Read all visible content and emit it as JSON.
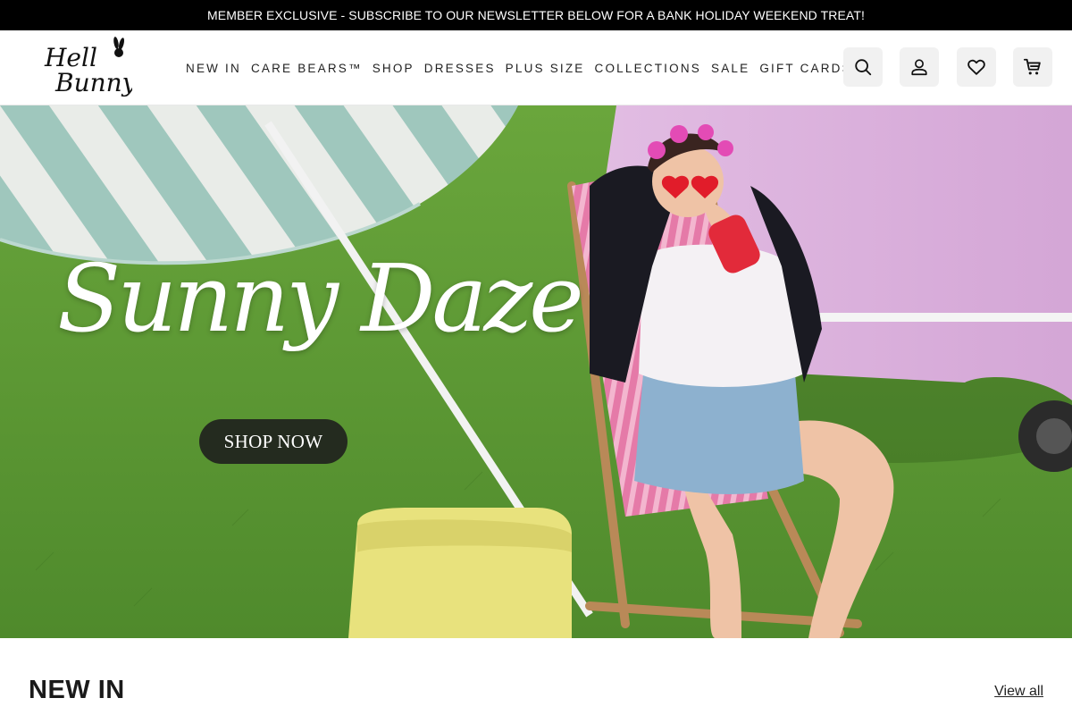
{
  "announcement": {
    "text": "MEMBER EXCLUSIVE - SUBSCRIBE TO OUR NEWSLETTER BELOW FOR A BANK HOLIDAY WEEKEND TREAT!"
  },
  "header": {
    "logo_text": "Hell Bunny",
    "nav": [
      {
        "label": "NEW IN"
      },
      {
        "label": "CARE BEARS™"
      },
      {
        "label": "SHOP"
      },
      {
        "label": "DRESSES"
      },
      {
        "label": "PLUS SIZE"
      },
      {
        "label": "COLLECTIONS"
      },
      {
        "label": "SALE"
      },
      {
        "label": "GIFT CARDS"
      }
    ],
    "icons": [
      "search-icon",
      "account-icon",
      "heart-icon",
      "cart-icon"
    ]
  },
  "hero": {
    "title": "Sunny Daze",
    "cta_label": "SHOP NOW"
  },
  "section": {
    "title": "NEW IN",
    "view_all_label": "View all"
  },
  "colors": {
    "announcement_bg": "#000000",
    "icon_button_bg": "#f1f1f1",
    "grass": "#5f9a36",
    "van": "#dcb2dd"
  }
}
